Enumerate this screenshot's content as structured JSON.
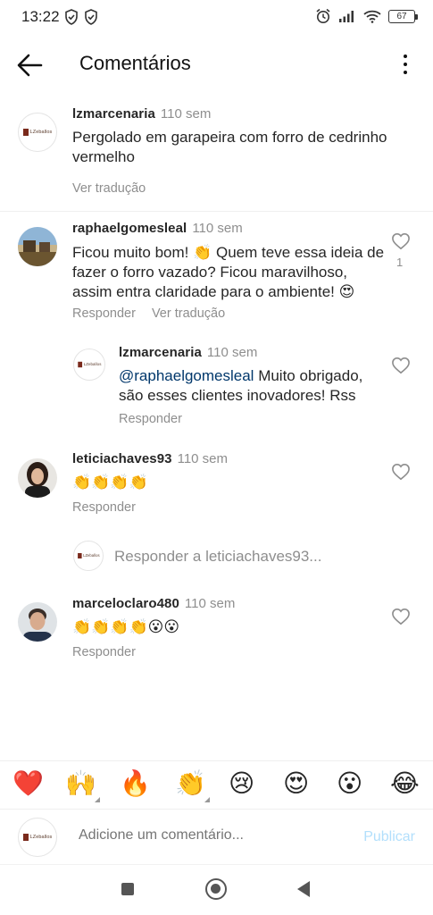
{
  "status_bar": {
    "time": "13:22",
    "battery": "67",
    "icons": [
      "shield-check-icon",
      "shield-check-icon",
      "alarm-icon",
      "signal-icon",
      "wifi-icon",
      "battery-icon"
    ]
  },
  "header": {
    "title": "Comentários",
    "back_icon": "arrow-left-icon",
    "more_icon": "more-vertical-icon"
  },
  "caption": {
    "username": "lzmarcenaria",
    "time": "110 sem",
    "text": "Pergolado em garapeira com forro de cedrinho vermelho",
    "translate": "Ver tradução"
  },
  "comments": [
    {
      "username": "raphaelgomesleal",
      "time": "110 sem",
      "text": "Ficou muito bom! 👏 Quem teve essa ideia de fazer o forro vazado? Ficou maravilhoso, assim entra claridade para o ambiente! 😍",
      "reply": "Responder",
      "translate": "Ver tradução",
      "likes": "1",
      "replies": [
        {
          "username": "lzmarcenaria",
          "time": "110 sem",
          "mention": "@raphaelgomesleal",
          "text": " Muito obrigado, são esses clientes inovadores! Rss",
          "reply": "Responder"
        }
      ]
    },
    {
      "username": "leticiachaves93",
      "time": "110 sem",
      "text": "👏👏👏👏",
      "reply": "Responder",
      "reply_prompt": "Responder a leticiachaves93..."
    },
    {
      "username": "marceloclaro480",
      "time": "110 sem",
      "text": "👏👏👏👏😮😮",
      "reply": "Responder"
    }
  ],
  "logo_text": "LZeballos",
  "emoji_bar": [
    "❤️",
    "🙌",
    "🔥",
    "👏",
    "😢",
    "😍",
    "😮",
    "😂"
  ],
  "composer": {
    "placeholder": "Adicione um comentário...",
    "publish": "Publicar"
  },
  "colors": {
    "link_blue": "#00376b",
    "publish_disabled": "#b2dffc",
    "secondary_text": "#8e8e8e"
  }
}
